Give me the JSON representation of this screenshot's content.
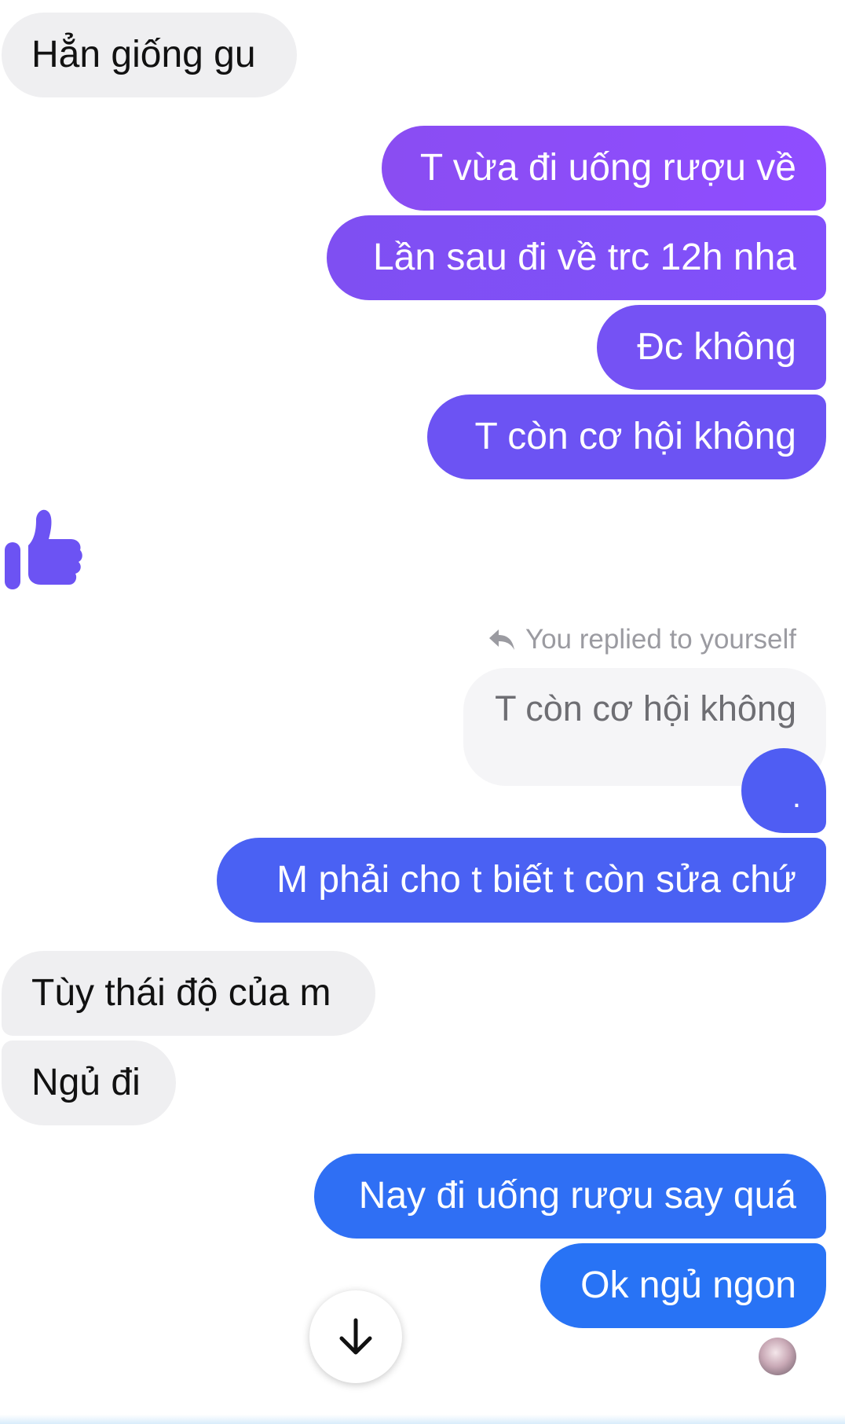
{
  "messages": [
    {
      "sender": "contact",
      "text": "Hẳn giống gu"
    },
    {
      "sender": "me",
      "text": "T vừa đi uống rượu về"
    },
    {
      "sender": "me",
      "text": "Lần sau đi về trc 12h nha"
    },
    {
      "sender": "me",
      "text": "Đc không"
    },
    {
      "sender": "me",
      "text": "T còn cơ hội không"
    },
    {
      "sender": "contact",
      "text": "",
      "icon": "thumbs-up-icon"
    },
    {
      "sender": "me",
      "reply_label": "You replied to yourself",
      "quoted_text": "T còn cơ hội không",
      "text": "."
    },
    {
      "sender": "me",
      "text": "M phải cho t biết t còn sửa chứ"
    },
    {
      "sender": "contact",
      "text": "Tùy thái độ của m"
    },
    {
      "sender": "contact",
      "text": "Ngủ đi"
    },
    {
      "sender": "me",
      "text": "Nay đi uống rượu say quá"
    },
    {
      "sender": "me",
      "text": "Ok ngủ ngon"
    }
  ],
  "controls": {
    "scroll_down_icon": "arrow-down-icon",
    "seen_indicator": "avatar"
  },
  "colors": {
    "incoming_bubble": "#efeff1",
    "outgoing_purple": "#8a4df2",
    "outgoing_blue": "#2873f5",
    "like_icon": "#6c53f3"
  }
}
